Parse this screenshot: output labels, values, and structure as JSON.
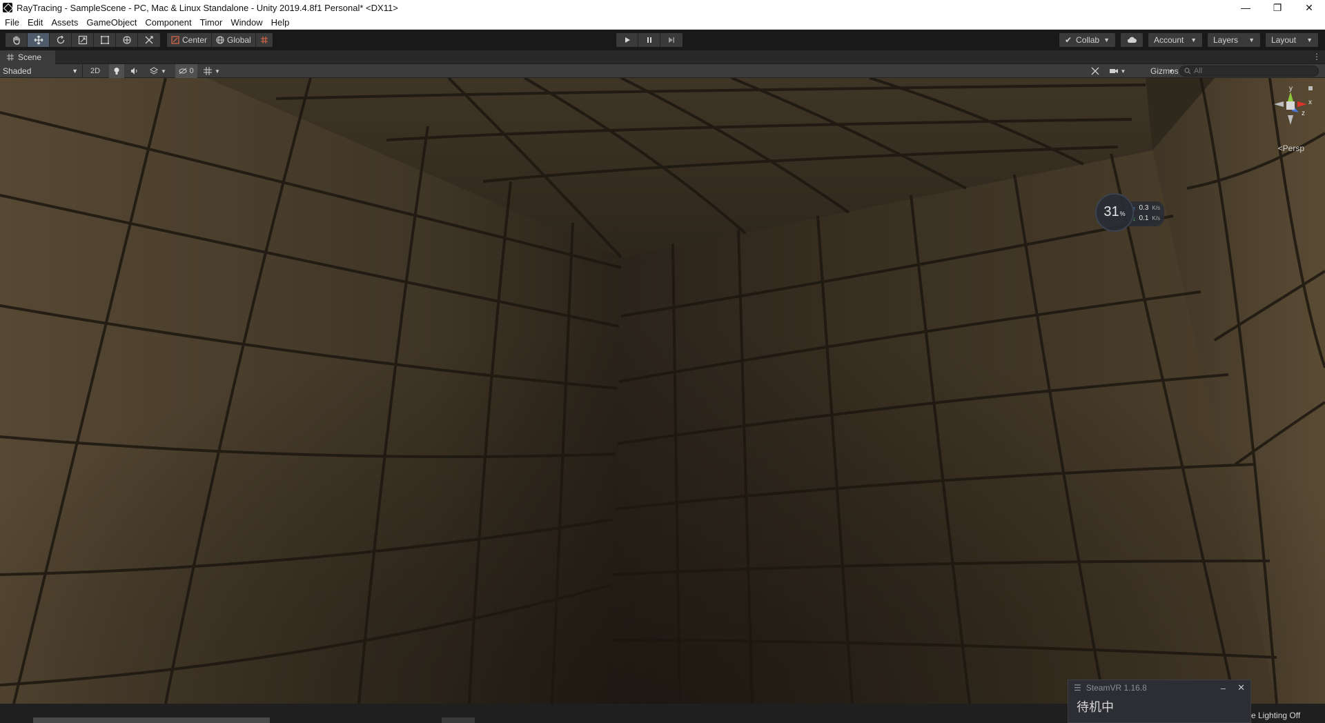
{
  "window": {
    "title": "RayTracing - SampleScene - PC, Mac & Linux Standalone - Unity 2019.4.8f1 Personal* <DX11>",
    "controls": {
      "minimize": "—",
      "restore": "❐",
      "close": "✕"
    }
  },
  "menu": [
    "File",
    "Edit",
    "Assets",
    "GameObject",
    "Component",
    "Timor",
    "Window",
    "Help"
  ],
  "toolbar": {
    "tools": [
      "hand-tool",
      "move-tool",
      "rotate-tool",
      "scale-tool",
      "rect-tool",
      "transform-tool",
      "custom-tool"
    ],
    "active_tool": "move-tool",
    "pivot": "Center",
    "space": "Global",
    "collab": "Collab",
    "account": "Account",
    "layers": "Layers",
    "layout": "Layout"
  },
  "scene": {
    "tab_label": "Scene",
    "shading_mode": "Shaded",
    "mode_2d": "2D",
    "hidden_count": "0",
    "gizmos": "Gizmos",
    "search_placeholder": "All",
    "projection": "Persp",
    "axis_labels": {
      "x": "x",
      "y": "y",
      "z": "z"
    }
  },
  "network": {
    "percent": "31",
    "percent_symbol": "%",
    "upload": "0.3",
    "download": "0.1",
    "unit": "K/s"
  },
  "steamvr": {
    "title": "SteamVR 1.16.8",
    "status": "待机中",
    "minimize": "–",
    "close": "✕"
  },
  "status": {
    "lighting": "e Lighting Off"
  },
  "colors": {
    "toolbar_bg": "#191919",
    "panel_bg": "#3c3c3c",
    "wall_light": "#6b5a3e",
    "wall_dark": "#241d14",
    "gizmo_x": "#d9352a",
    "gizmo_y": "#8fc83a",
    "gizmo_z": "#4a78d8"
  }
}
